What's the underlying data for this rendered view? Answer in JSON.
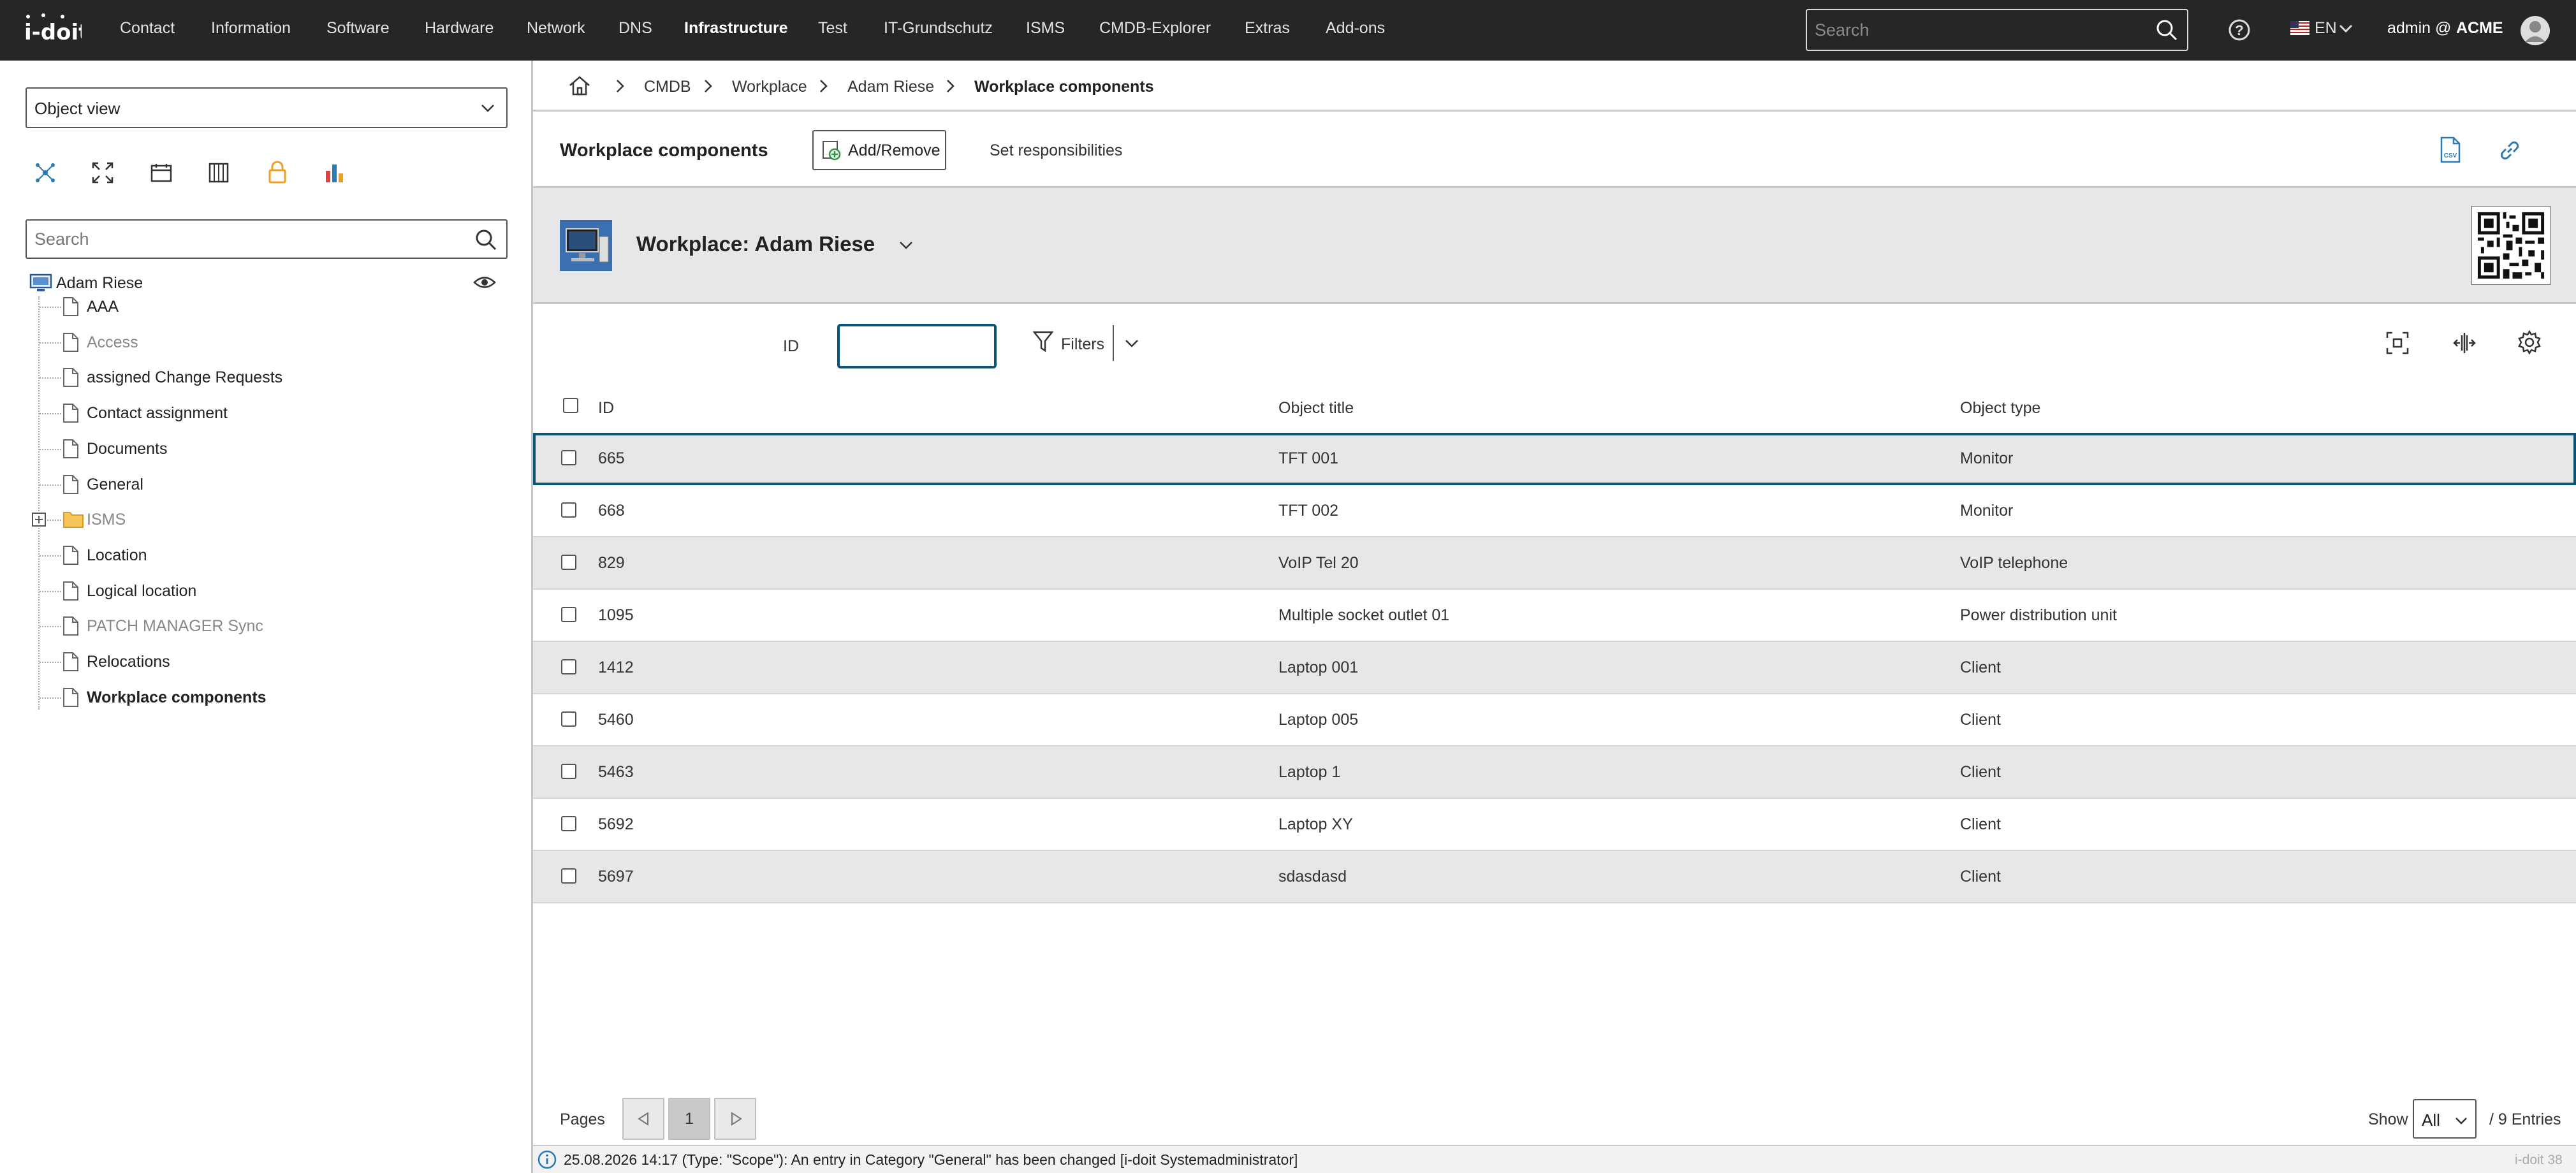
{
  "app": {
    "logo": "i-doit",
    "version": "i-doit 38"
  },
  "topnav": {
    "items": [
      "Contact",
      "Information",
      "Software",
      "Hardware",
      "Network",
      "DNS",
      "Infrastructure",
      "Test",
      "IT-Grundschutz",
      "ISMS",
      "CMDB-Explorer",
      "Extras",
      "Add-ons"
    ],
    "active": "Infrastructure",
    "search_placeholder": "Search",
    "language": "EN",
    "user": "admin @",
    "tenant": "ACME"
  },
  "sidebar": {
    "view_select": "Object view",
    "search_placeholder": "Search",
    "tree_root": "Adam Riese",
    "tree_items": [
      {
        "label": "AAA",
        "style": "normal"
      },
      {
        "label": "Access",
        "style": "grey"
      },
      {
        "label": "assigned Change Requests",
        "style": "normal"
      },
      {
        "label": "Contact assignment",
        "style": "normal"
      },
      {
        "label": "Documents",
        "style": "normal"
      },
      {
        "label": "General",
        "style": "normal"
      },
      {
        "label": "ISMS",
        "style": "grey"
      },
      {
        "label": "Location",
        "style": "normal"
      },
      {
        "label": "Logical location",
        "style": "normal"
      },
      {
        "label": "PATCH MANAGER Sync",
        "style": "grey"
      },
      {
        "label": "Relocations",
        "style": "normal"
      },
      {
        "label": "Workplace components",
        "style": "bold"
      }
    ]
  },
  "breadcrumb": {
    "items": [
      "CMDB",
      "Workplace",
      "Adam Riese"
    ],
    "current": "Workplace components"
  },
  "toolbar": {
    "title": "Workplace components",
    "add_remove": "Add/Remove",
    "set_responsibilities": "Set responsibilities"
  },
  "object": {
    "title": "Workplace: Adam Riese"
  },
  "filter": {
    "id_label": "ID",
    "id_value": "",
    "filters_label": "Filters"
  },
  "table": {
    "columns": [
      "ID",
      "Object title",
      "Object type"
    ],
    "rows": [
      {
        "id": "665",
        "title": "TFT 001",
        "type": "Monitor"
      },
      {
        "id": "668",
        "title": "TFT 002",
        "type": "Monitor"
      },
      {
        "id": "829",
        "title": "VoIP Tel 20",
        "type": "VoIP telephone"
      },
      {
        "id": "1095",
        "title": "Multiple socket outlet 01",
        "type": "Power distribution unit"
      },
      {
        "id": "1412",
        "title": "Laptop 001",
        "type": "Client"
      },
      {
        "id": "5460",
        "title": "Laptop 005",
        "type": "Client"
      },
      {
        "id": "5463",
        "title": "Laptop 1",
        "type": "Client"
      },
      {
        "id": "5692",
        "title": "Laptop XY",
        "type": "Client"
      },
      {
        "id": "5697",
        "title": "sdasdasd",
        "type": "Client"
      }
    ]
  },
  "pagination": {
    "pages_label": "Pages",
    "current_page": "1",
    "show_label": "Show",
    "show_value": "All",
    "entries": "/ 9 Entries"
  },
  "status": {
    "message": "25.08.2026 14:17 (Type: \"Scope\"): An entry in Category \"General\" has been changed [i-doit Systemadministrator]"
  }
}
